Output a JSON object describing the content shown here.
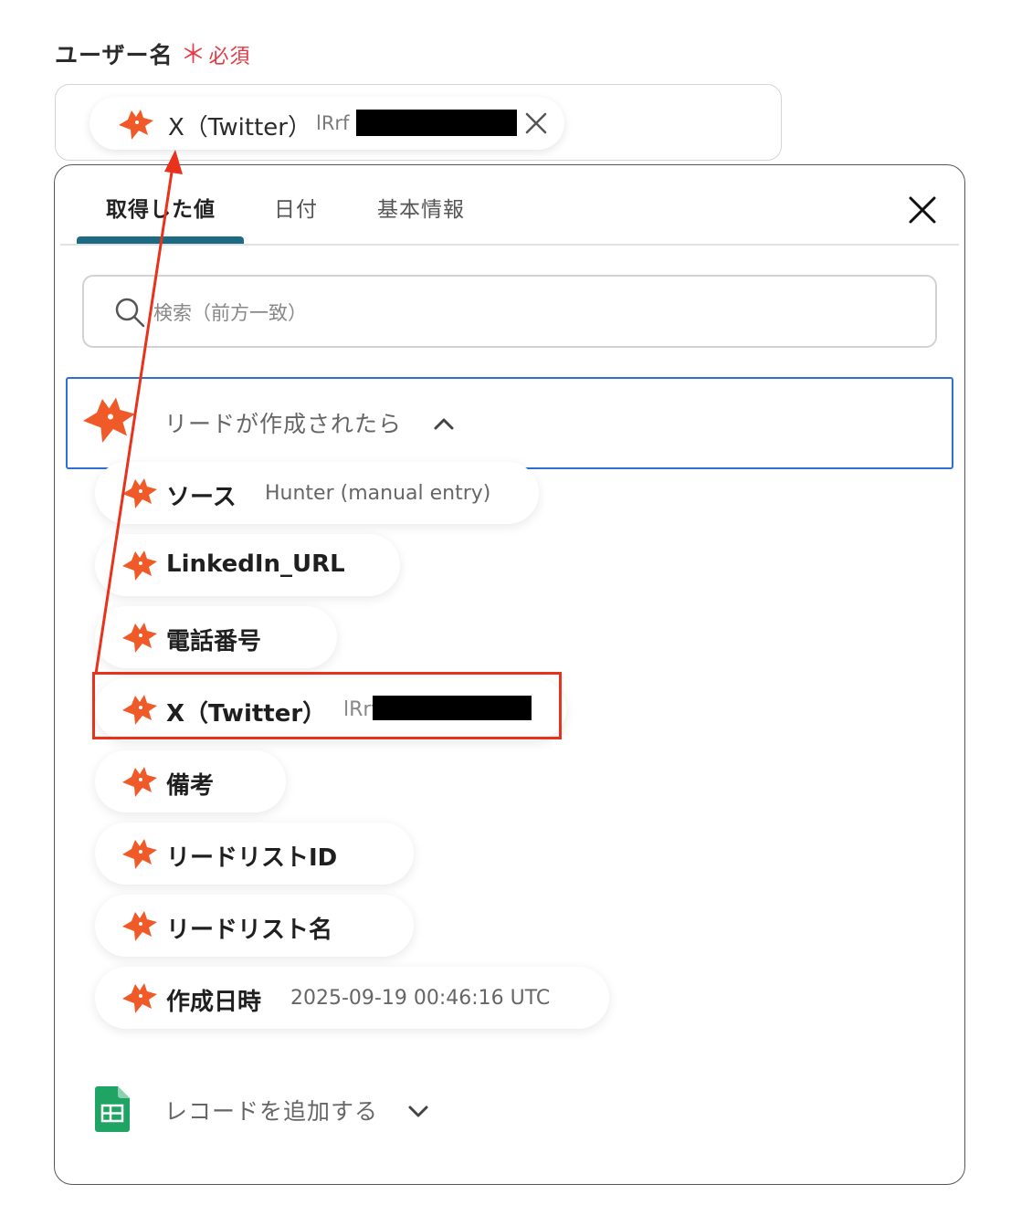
{
  "field": {
    "label": "ユーザー名",
    "required_mark": "＊",
    "required_text": "必須"
  },
  "selected_chip": {
    "name": "X（Twitter）",
    "value_visible": "lRrf",
    "remove_icon": "close-icon"
  },
  "tabs": [
    {
      "label": "取得した値",
      "active": true
    },
    {
      "label": "日付",
      "active": false
    },
    {
      "label": "基本情報",
      "active": false
    }
  ],
  "panel_close_icon": "close-icon",
  "search": {
    "placeholder": "検索（前方一致）",
    "icon": "search-icon"
  },
  "group": {
    "title": "リードが作成されたら",
    "expanded": true,
    "icon": "hunter-fox-icon",
    "items": [
      {
        "label": "ソース",
        "value": "Hunter (manual entry)"
      },
      {
        "label": "LinkedIn_URL",
        "value": ""
      },
      {
        "label": "電話番号",
        "value": ""
      },
      {
        "label": "X（Twitter）",
        "value": "lRrf",
        "highlighted": true
      },
      {
        "label": "備考",
        "value": ""
      },
      {
        "label": "リードリストID",
        "value": ""
      },
      {
        "label": "リードリスト名",
        "value": ""
      },
      {
        "label": "作成日時",
        "value": "2025-09-19 00:46:16 UTC"
      }
    ]
  },
  "group2": {
    "title": "レコードを追加する",
    "expanded": false,
    "icon": "google-sheets-icon"
  },
  "colors": {
    "accent_tab": "#1c6b82",
    "group_border": "#2f6fd1",
    "annotation_red": "#e8321b",
    "required_red": "#e63946",
    "fox_orange": "#f05a28",
    "sheets_green": "#1fa463"
  }
}
